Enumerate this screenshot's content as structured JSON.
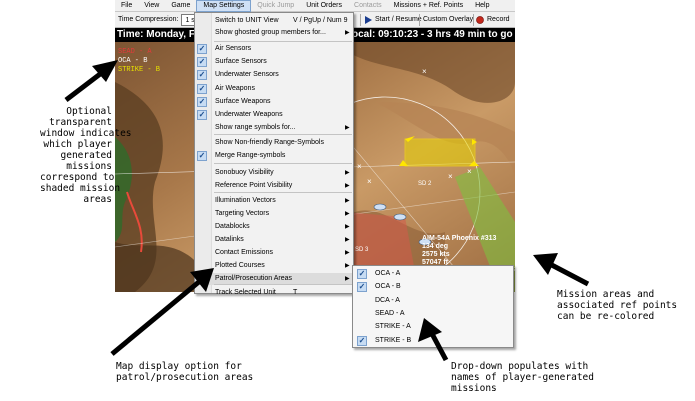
{
  "menubar": {
    "items": [
      "File",
      "View",
      "Game",
      "Map Settings",
      "Quick Jump",
      "Unit Orders",
      "Contacts",
      "Missions + Ref. Points",
      "Help"
    ]
  },
  "toolbar": {
    "time_compression_label": "Time Compression:",
    "time_compression_value": "1 sec",
    "start_resume_label": "Start / Resume",
    "custom_overlay_label": "Custom Overlay",
    "record_label": "Record"
  },
  "statusbar": {
    "time_text": "Time: Monday, F",
    "local_text": "ocal: 09:10:23 - 3 hrs 49 min to go - Came"
  },
  "legend": {
    "items": [
      {
        "label": "SEAD - A",
        "color": "#e23b3b"
      },
      {
        "label": "OCA - B",
        "color": "#ffffff"
      },
      {
        "label": "STRIKE - B",
        "color": "#e6e000"
      }
    ]
  },
  "map": {
    "unit_label_name": "AIM-54A Phoenix #313",
    "unit_label_course": "134 deg",
    "unit_label_speed": "2575 kts",
    "unit_label_alt": "57047 ft",
    "ref_sd": "SD 2",
    "ref_sd3": "SD 3",
    "search_label": "search",
    "colors": {
      "terrain_dark": "#5a3d22",
      "terrain_mid": "#9a6b42",
      "terrain_light": "#c99a66",
      "green_area": "#7fbf3f",
      "yellow_area": "#e6d200",
      "red_area": "#d45a4a"
    }
  },
  "dropdown": {
    "items": [
      {
        "label": "Switch to UNIT View",
        "key": "V / PgUp / Num 9",
        "checked": false,
        "submenu": false
      },
      {
        "label": "Show ghosted group members for...",
        "key": "",
        "checked": false,
        "submenu": true
      },
      {
        "label": "Air Sensors",
        "key": "",
        "checked": true,
        "submenu": false
      },
      {
        "label": "Surface Sensors",
        "key": "",
        "checked": true,
        "submenu": false
      },
      {
        "label": "Underwater Sensors",
        "key": "",
        "checked": true,
        "submenu": false
      },
      {
        "label": "Air Weapons",
        "key": "",
        "checked": true,
        "submenu": false
      },
      {
        "label": "Surface Weapons",
        "key": "",
        "checked": true,
        "submenu": false
      },
      {
        "label": "Underwater Weapons",
        "key": "",
        "checked": true,
        "submenu": false
      },
      {
        "label": "Show range symbols for...",
        "key": "",
        "checked": false,
        "submenu": true
      },
      {
        "label": "Show Non-friendly Range-Symbols",
        "key": "",
        "checked": false,
        "submenu": false
      },
      {
        "label": "Merge Range-symbols",
        "key": "",
        "checked": true,
        "submenu": false
      },
      {
        "label": "Sonobuoy Visibility",
        "key": "",
        "checked": false,
        "submenu": true
      },
      {
        "label": "Reference Point Visibility",
        "key": "",
        "checked": false,
        "submenu": true
      },
      {
        "label": "Illumination Vectors",
        "key": "",
        "checked": false,
        "submenu": true
      },
      {
        "label": "Targeting Vectors",
        "key": "",
        "checked": false,
        "submenu": true
      },
      {
        "label": "Datablocks",
        "key": "",
        "checked": false,
        "submenu": true
      },
      {
        "label": "Datalinks",
        "key": "",
        "checked": false,
        "submenu": true
      },
      {
        "label": "Contact Emissions",
        "key": "",
        "checked": false,
        "submenu": true
      },
      {
        "label": "Plotted Courses",
        "key": "",
        "checked": false,
        "submenu": true
      },
      {
        "label": "Patrol/Prosecution Areas",
        "key": "",
        "checked": false,
        "submenu": true
      },
      {
        "label": "Track Selected Unit",
        "key": "T",
        "checked": false,
        "submenu": false
      }
    ]
  },
  "submenu": {
    "items": [
      {
        "label": "OCA - A",
        "checked": true
      },
      {
        "label": "OCA - B",
        "checked": true
      },
      {
        "label": "DCA - A",
        "checked": false
      },
      {
        "label": "SEAD - A",
        "checked": false
      },
      {
        "label": "STRIKE - A",
        "checked": false
      },
      {
        "label": "STRIKE - B",
        "checked": true
      }
    ]
  },
  "annotations": {
    "left": [
      "Optional",
      "transparent",
      "window indicates",
      "which player",
      "generated",
      "missions",
      "correspond to",
      "shaded mission",
      "areas"
    ],
    "right": [
      "Mission areas and",
      "associated ref points",
      "can be re-colored"
    ],
    "bottom_left": [
      "Map display option for",
      "patrol/prosecution areas"
    ],
    "bottom_right": [
      "Drop-down populates with",
      "names of player-generated",
      "missions"
    ]
  }
}
